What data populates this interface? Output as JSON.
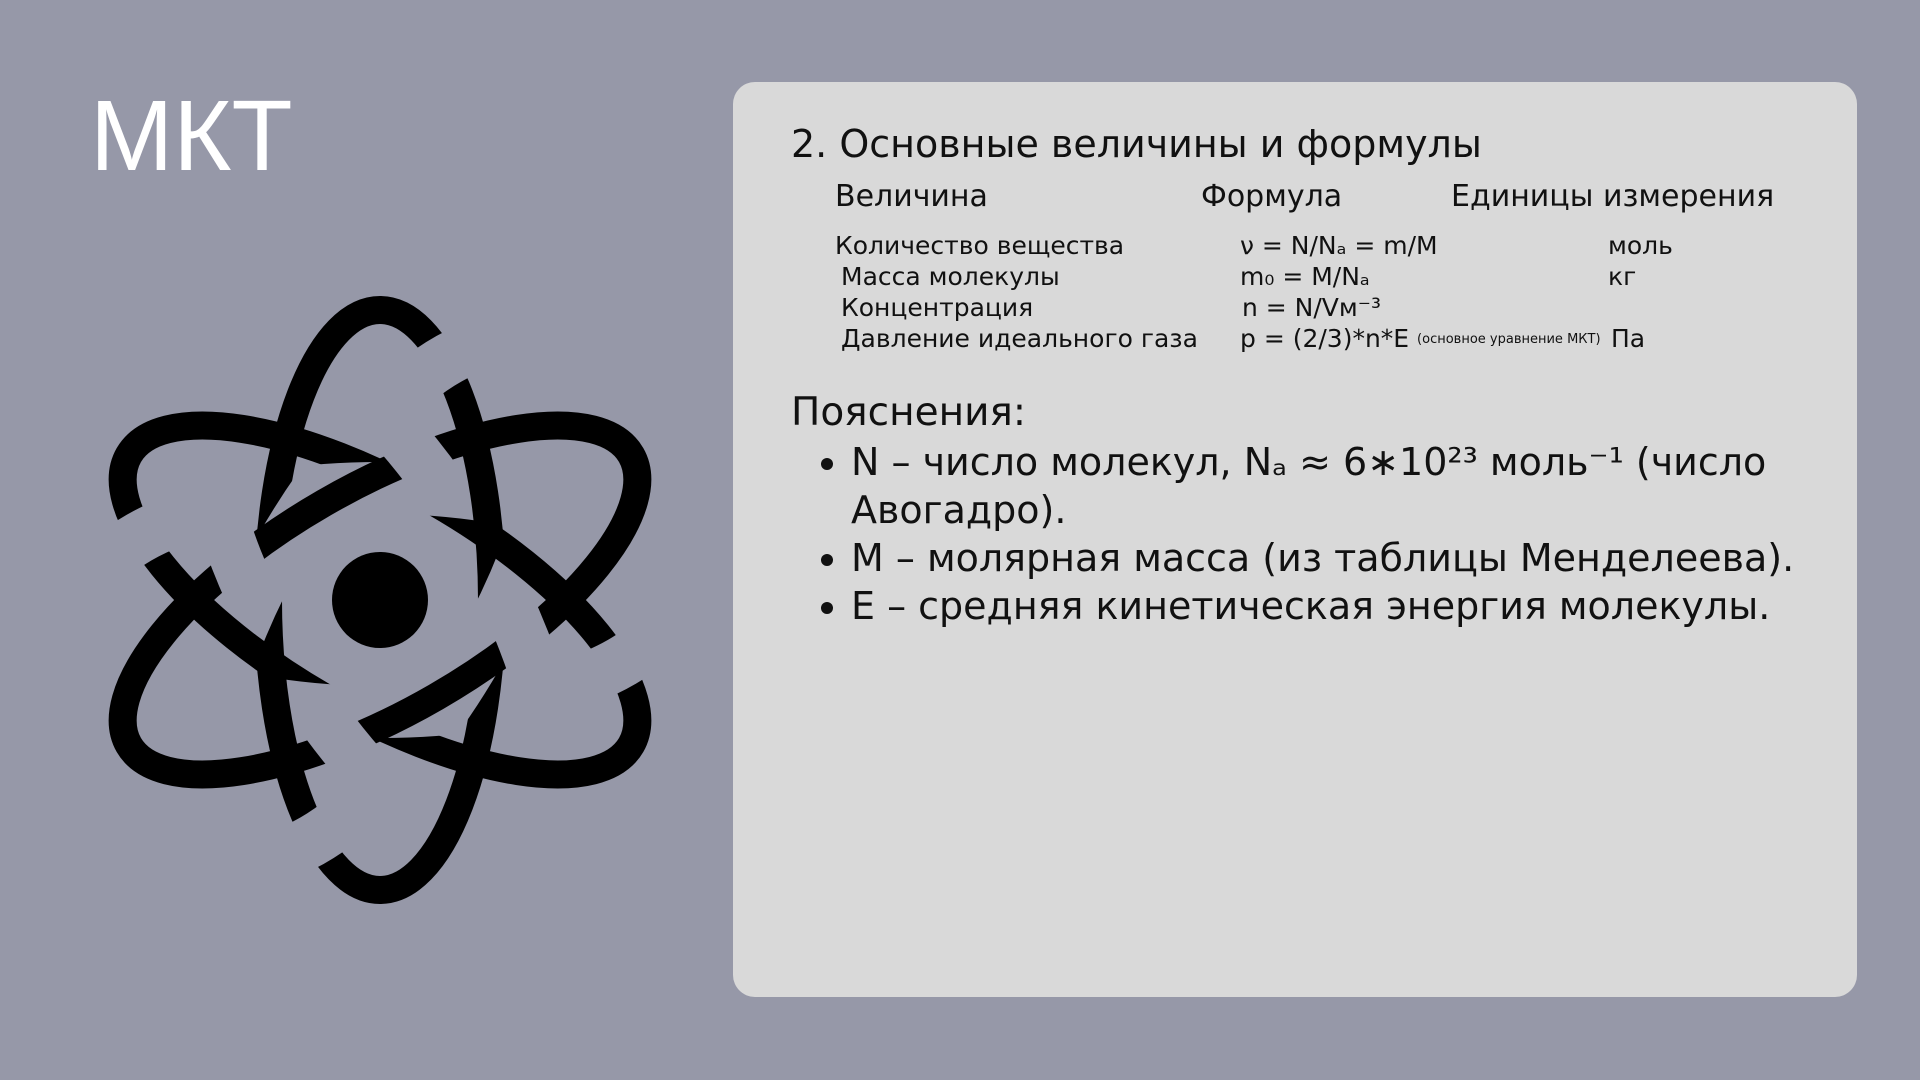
{
  "slide": {
    "title": "МКТ"
  },
  "icon": {
    "name": "atom-icon",
    "color": "#000000"
  },
  "card": {
    "heading": "2. Основные величины и формулы",
    "columns": {
      "quantity": "Величина",
      "formula": "Формула",
      "units": "Единицы измерения"
    },
    "rows": [
      {
        "quantity": "Количество вещества",
        "formula": "ν = N/Nₐ = m/M",
        "formula_note": "",
        "unit": "моль"
      },
      {
        "quantity": "Масса молекулы",
        "formula": "m₀ = M/Nₐ",
        "formula_note": "",
        "unit": "кг"
      },
      {
        "quantity": "Концентрация",
        "formula": "n = N/Vм⁻³",
        "formula_note": "",
        "unit": ""
      },
      {
        "quantity": "Давление идеального газа",
        "formula": "p = (2/3)*n*E",
        "formula_note": "(основное уравнение МКТ)",
        "unit": "Па"
      }
    ],
    "notes_heading": "Пояснения:",
    "notes": [
      "N – число молекул, Nₐ ≈ 6∗10²³ моль⁻¹ (число Авогадро).",
      "M – молярная масса (из таблицы Менделеева).",
      "E – средняя кинетическая энергия молекулы."
    ]
  }
}
